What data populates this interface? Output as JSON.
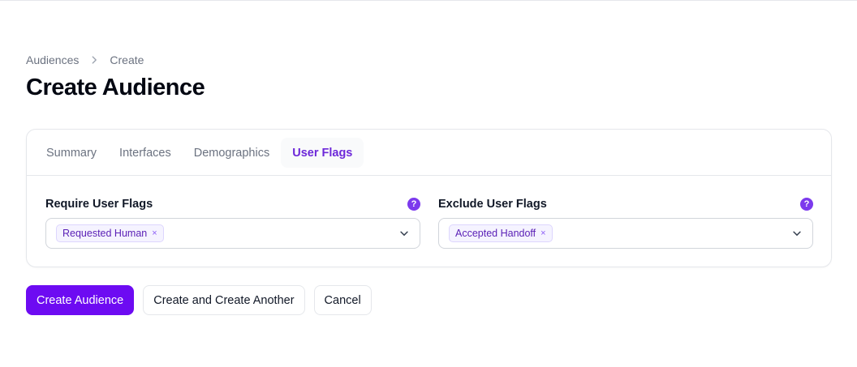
{
  "breadcrumb": {
    "parent": "Audiences",
    "current": "Create"
  },
  "page": {
    "title": "Create Audience"
  },
  "tabs": [
    {
      "label": "Summary",
      "active": false
    },
    {
      "label": "Interfaces",
      "active": false
    },
    {
      "label": "Demographics",
      "active": false
    },
    {
      "label": "User Flags",
      "active": true
    }
  ],
  "fields": {
    "require": {
      "label": "Require User Flags",
      "help_icon": "?",
      "selected": [
        "Requested Human"
      ]
    },
    "exclude": {
      "label": "Exclude User Flags",
      "help_icon": "?",
      "selected": [
        "Accepted Handoff"
      ]
    }
  },
  "chip_remove": "×",
  "actions": {
    "create": "Create Audience",
    "create_another": "Create and Create Another",
    "cancel": "Cancel"
  },
  "colors": {
    "primary": "#6d0bf2",
    "accent_text": "#6d28d9",
    "help_icon": "#7c3aed"
  }
}
